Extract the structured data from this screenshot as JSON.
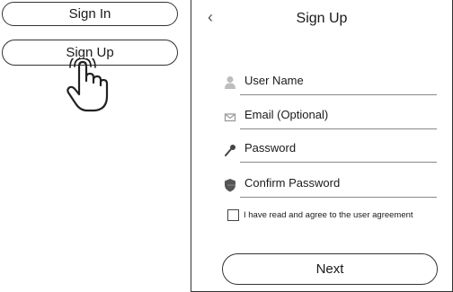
{
  "left_panel": {
    "sign_in_label": "Sign In",
    "sign_up_label": "Sign Up",
    "cursor_icon": "hand-pointer-icon"
  },
  "signup_screen": {
    "title": "Sign Up",
    "back_icon": "chevron-left-icon",
    "fields": [
      {
        "label": "User Name",
        "icon": "person-icon"
      },
      {
        "label": "Email (Optional)",
        "icon": "envelope-icon"
      },
      {
        "label": "Password",
        "icon": "key-icon"
      },
      {
        "label": "Confirm Password",
        "icon": "shield-icon"
      }
    ],
    "agreement_text": "I have read and agree to the user agreement",
    "agreement_checked": false,
    "next_label": "Next"
  }
}
